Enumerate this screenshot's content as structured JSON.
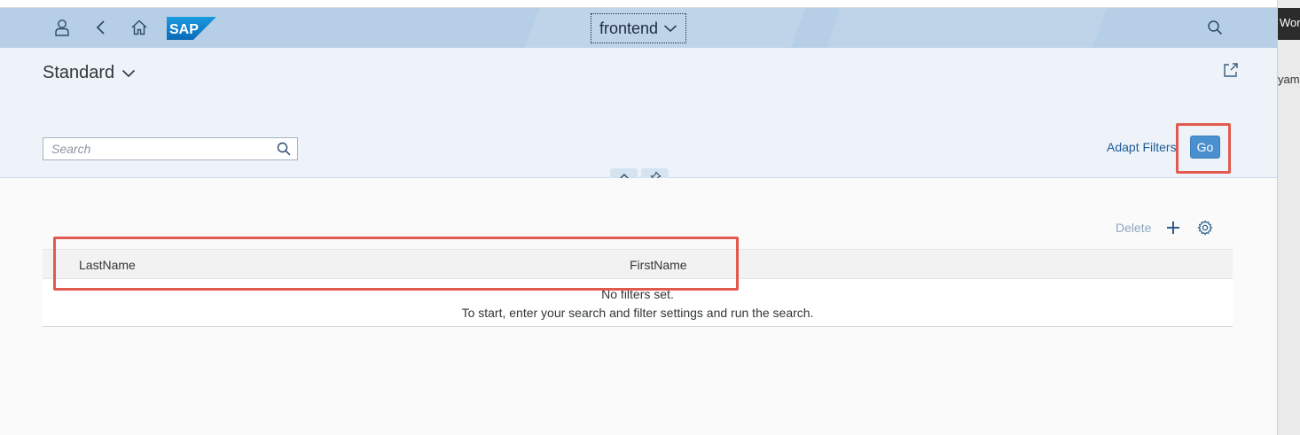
{
  "shell": {
    "app_title": "frontend",
    "logo_text": "SAP",
    "icons": [
      "user-icon",
      "back-icon",
      "home-icon",
      "search-icon"
    ]
  },
  "right_panel": {
    "tab_text": "Work",
    "file_text": "yaml"
  },
  "header": {
    "variant_label": "Standard",
    "search_placeholder": "Search",
    "adapt_filters_label": "Adapt Filters",
    "go_label": "Go"
  },
  "table": {
    "toolbar": {
      "delete_label": "Delete"
    },
    "columns": [
      "LastName",
      "FirstName"
    ],
    "no_data_line1": "No filters set.",
    "no_data_line2": "To start, enter your search and filter settings and run the search."
  },
  "colors": {
    "shell_bg": "#b7cfe6",
    "header_bg": "#edf3f9",
    "go_button": "#4a90cf",
    "highlight": "#e25a4f"
  }
}
